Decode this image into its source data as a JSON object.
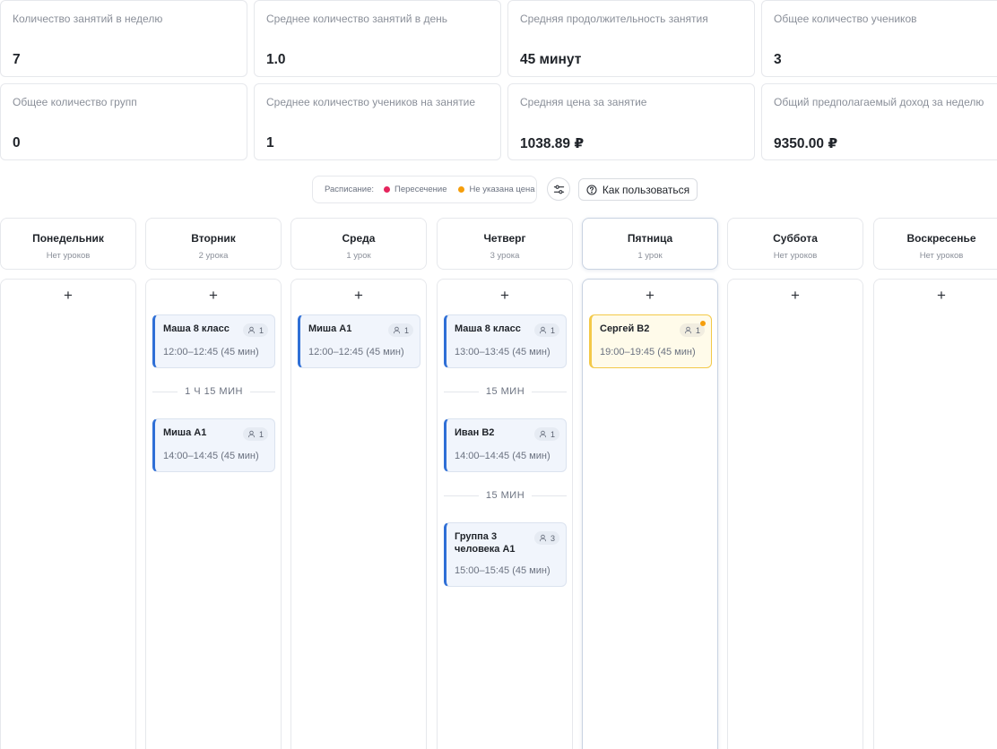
{
  "stats": [
    {
      "label": "Количество занятий в неделю",
      "value": "7"
    },
    {
      "label": "Среднее количество занятий в день",
      "value": "1.0"
    },
    {
      "label": "Средняя продолжительность занятия",
      "value": "45 минут"
    },
    {
      "label": "Общее количество учеников",
      "value": "3"
    },
    {
      "label": "Общее количество групп",
      "value": "0"
    },
    {
      "label": "Среднее количество учеников на занятие",
      "value": "1"
    },
    {
      "label": "Средняя цена за занятие",
      "value": "1038.89 ₽"
    },
    {
      "label": "Общий предполагаемый доход за неделю",
      "value": "9350.00 ₽"
    }
  ],
  "legend": {
    "title": "Расписание:",
    "overlap": "Пересечение",
    "no_price": "Не указана цена",
    "overlap_color": "#e5255d",
    "no_price_color": "#f59e0b"
  },
  "toolbar": {
    "filter_icon": "sliders-icon",
    "help_label": "Как пользоваться"
  },
  "add_symbol": "+",
  "days": [
    {
      "name": "Понедельник",
      "count": "Нет уроков",
      "items": []
    },
    {
      "name": "Вторник",
      "count": "2 урока",
      "items": [
        {
          "kind": "lesson",
          "title": "Маша 8 класс",
          "students": "1",
          "time": "12:00–12:45 (45 мин)"
        },
        {
          "kind": "gap",
          "label": "1 Ч 15 МИН"
        },
        {
          "kind": "lesson",
          "title": "Миша А1",
          "students": "1",
          "time": "14:00–14:45 (45 мин)"
        }
      ]
    },
    {
      "name": "Среда",
      "count": "1 урок",
      "items": [
        {
          "kind": "lesson",
          "title": "Миша А1",
          "students": "1",
          "time": "12:00–12:45 (45 мин)"
        }
      ]
    },
    {
      "name": "Четверг",
      "count": "3 урока",
      "items": [
        {
          "kind": "lesson",
          "title": "Маша 8 класс",
          "students": "1",
          "time": "13:00–13:45 (45 мин)"
        },
        {
          "kind": "gap",
          "label": "15 МИН"
        },
        {
          "kind": "lesson",
          "title": "Иван В2",
          "students": "1",
          "time": "14:00–14:45 (45 мин)"
        },
        {
          "kind": "gap",
          "label": "15 МИН"
        },
        {
          "kind": "lesson",
          "title": "Группа 3 человека А1",
          "students": "3",
          "time": "15:00–15:45 (45 мин)"
        }
      ]
    },
    {
      "name": "Пятница",
      "count": "1 урок",
      "active": true,
      "items": [
        {
          "kind": "lesson",
          "title": "Сергей В2",
          "students": "1",
          "time": "19:00–19:45 (45 мин)",
          "no_price": true
        }
      ]
    },
    {
      "name": "Суббота",
      "count": "Нет уроков",
      "items": []
    },
    {
      "name": "Воскресенье",
      "count": "Нет уроков",
      "items": []
    }
  ]
}
